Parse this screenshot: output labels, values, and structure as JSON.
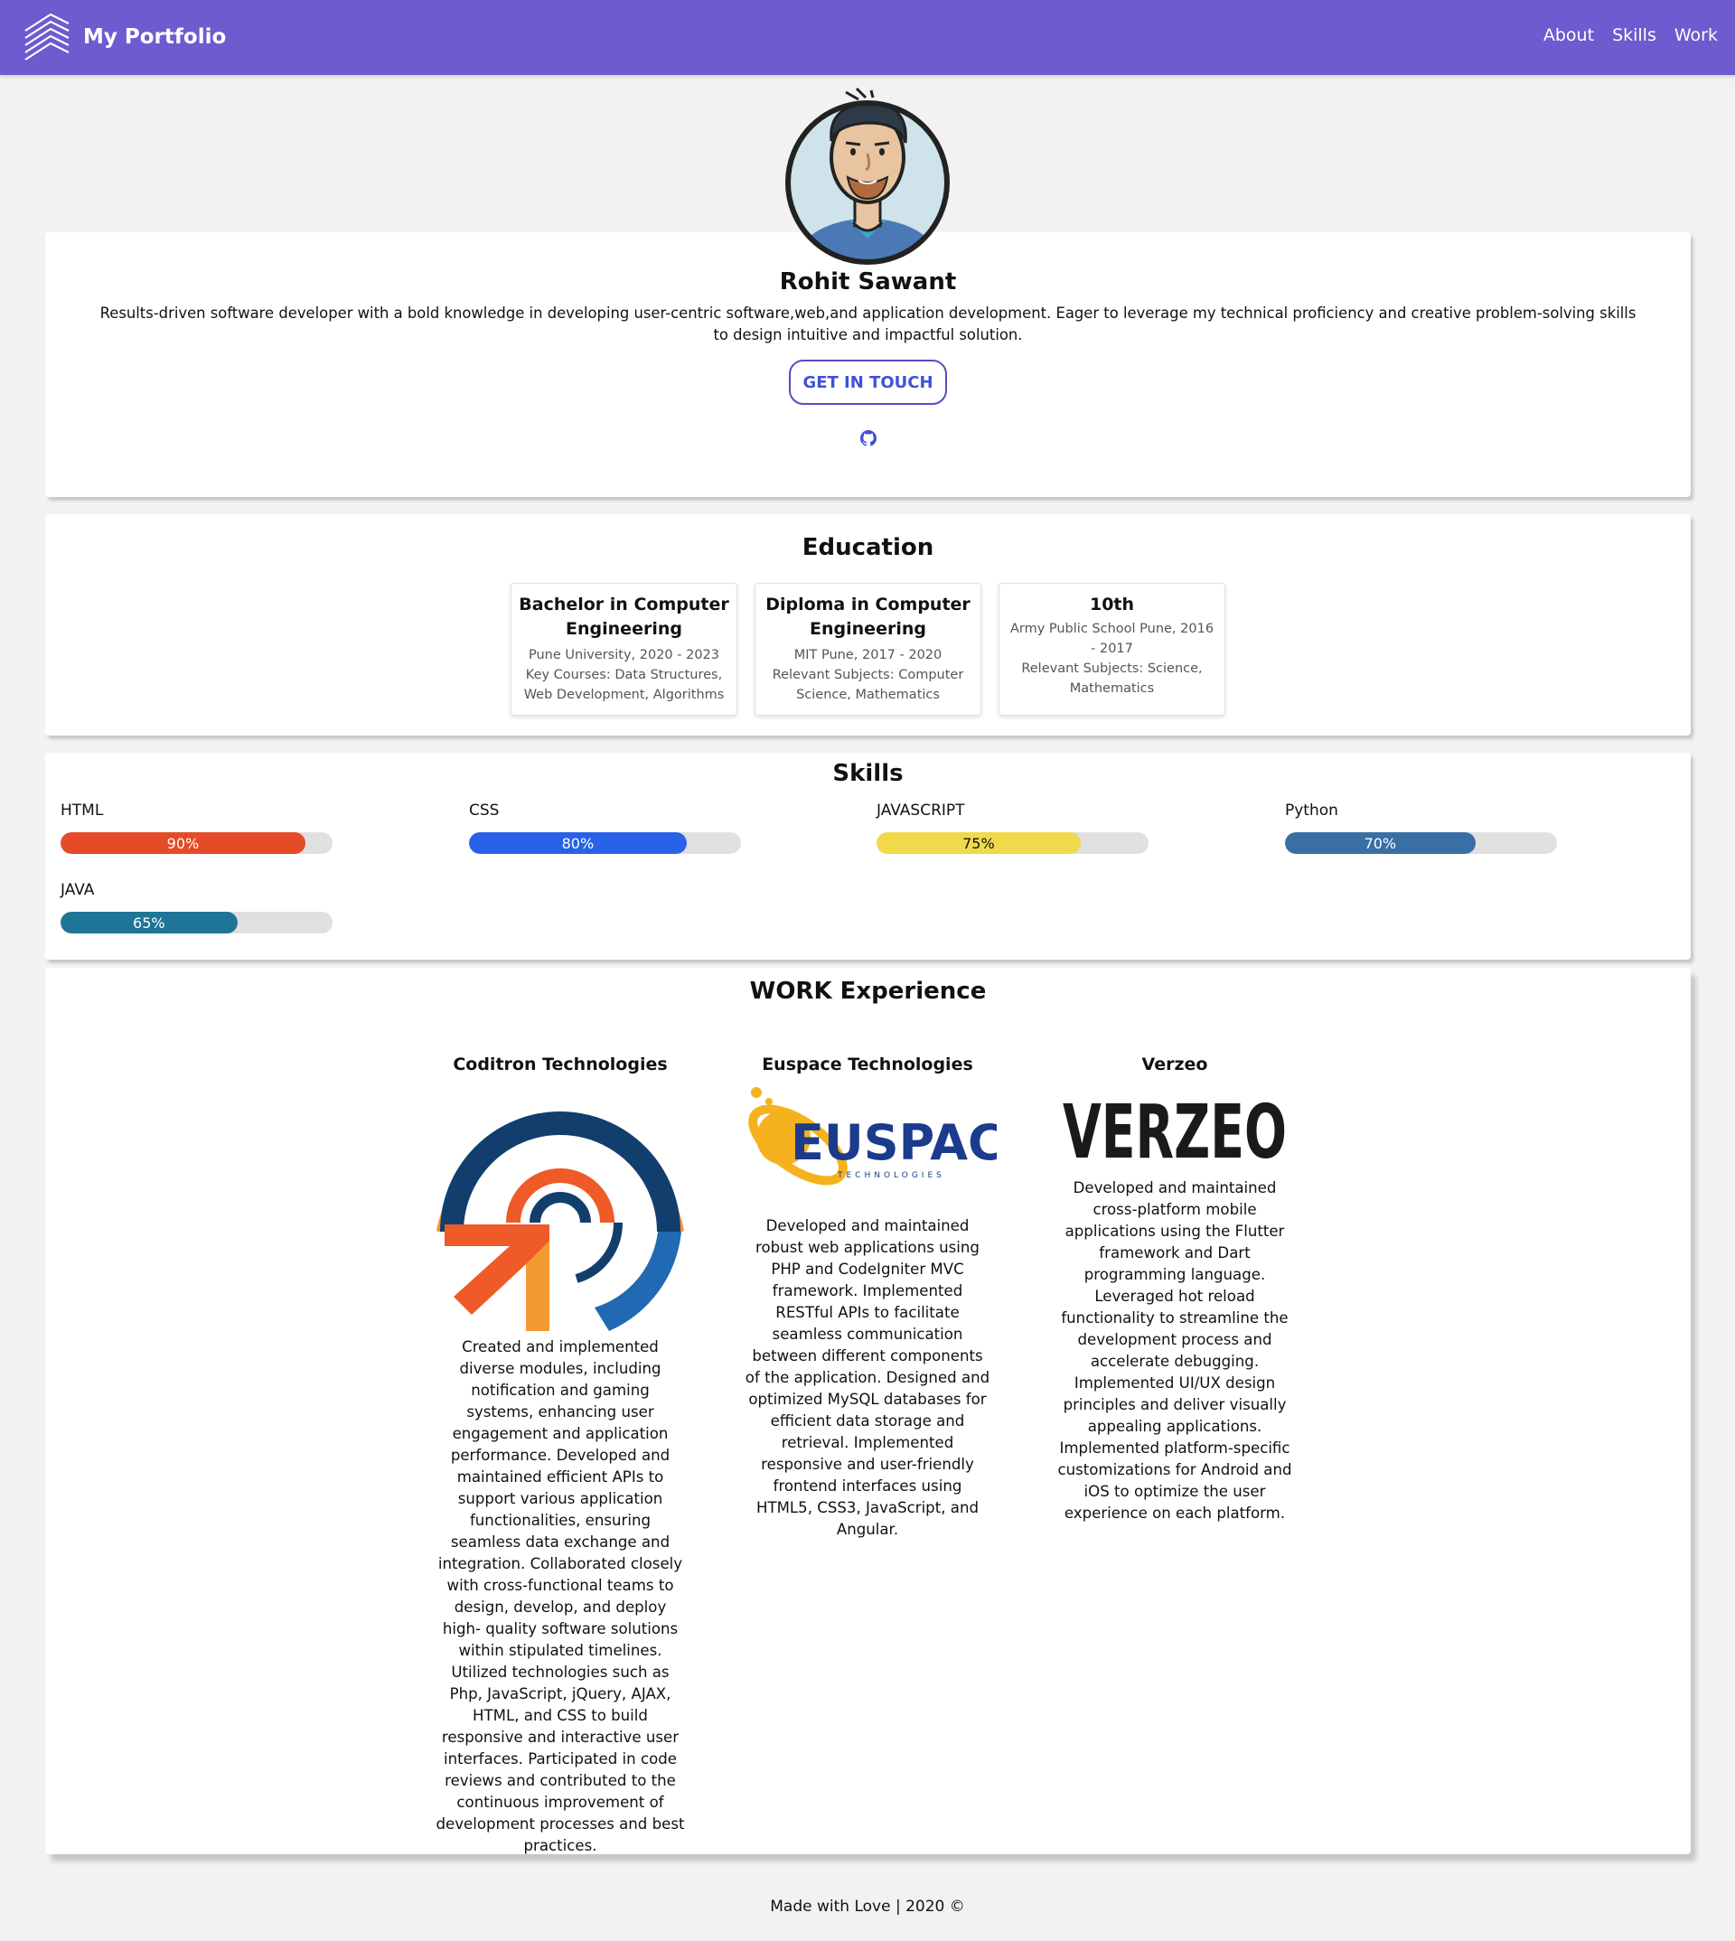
{
  "navbar": {
    "title": "My Portfolio",
    "links": [
      "About",
      "Skills",
      "Work"
    ],
    "bg_color": "#6f5acf"
  },
  "hero": {
    "name": "Rohit Sawant",
    "bio": "Results-driven software developer with a bold knowledge in developing user-centric software,web,and application development. Eager to leverage my technical proficiency and creative problem-solving skills to design intuitive and impactful solution.",
    "cta_label": "GET IN TOUCH",
    "social_icon": "github-icon"
  },
  "education": {
    "title": "Education",
    "items": [
      {
        "degree": "Bachelor in Computer Engineering",
        "institution": "Pune University, 2020 - 2023",
        "subjects": "Key Courses: Data Structures, Web Development, Algorithms"
      },
      {
        "degree": "Diploma in Computer Engineering",
        "institution": "MIT Pune, 2017 - 2020",
        "subjects": "Relevant Subjects: Computer Science, Mathematics"
      },
      {
        "degree": "10th",
        "institution": "Army Public School Pune, 2016 - 2017",
        "subjects": "Relevant Subjects: Science, Mathematics"
      }
    ]
  },
  "skills": {
    "title": "Skills",
    "items": [
      {
        "name": "HTML",
        "label": "90%",
        "level": 0.9,
        "color": "#e54b26",
        "text_color": "#ffffff"
      },
      {
        "name": "CSS",
        "label": "80%",
        "level": 0.8,
        "color": "#2962e8",
        "text_color": "#ffffff"
      },
      {
        "name": "JAVASCRIPT",
        "label": "75%",
        "level": 0.75,
        "color": "#f0d94a",
        "text_color": "#111111"
      },
      {
        "name": "Python",
        "label": "70%",
        "level": 0.7,
        "color": "#3a6fa6",
        "text_color": "#ffffff"
      },
      {
        "name": "JAVA",
        "label": "65%",
        "level": 0.65,
        "color": "#1e7598",
        "text_color": "#ffffff"
      }
    ]
  },
  "work": {
    "title": "WORK Experience",
    "jobs": [
      {
        "company": "Coditron Technologies",
        "logo": "coditron-logo",
        "description": "Created and implemented diverse modules, including notification and gaming systems, enhancing user engagement and application performance. Developed and maintained efficient APIs to support various application functionalities, ensuring seamless data exchange and integration. Collaborated closely with cross-functional teams to design, develop, and deploy high- quality software solutions within stipulated timelines. Utilized technologies such as Php, JavaScript, jQuery, AJAX, HTML, and CSS to build responsive and interactive user interfaces. Participated in code reviews and contributed to the continuous improvement of development processes and best practices."
      },
      {
        "company": "Euspace Technologies",
        "logo": "euspace-logo",
        "logo_text": "EUSPACE",
        "logo_subtext": "TECHNOLOGIES",
        "description": "Developed and maintained robust web applications using PHP and CodeIgniter MVC framework. Implemented RESTful APIs to facilitate seamless communication between different components of the application. Designed and optimized MySQL databases for efficient data storage and retrieval. Implemented responsive and user-friendly frontend interfaces using HTML5, CSS3, JavaScript, and Angular."
      },
      {
        "company": "Verzeo",
        "logo": "verzeo-logo",
        "logo_text": "VERZEO",
        "description": "Developed and maintained cross-platform mobile applications using the Flutter framework and Dart programming language. Leveraged hot reload functionality to streamline the development process and accelerate debugging. Implemented UI/UX design principles and deliver visually appealing applications. Implemented platform-specific customizations for Android and iOS to optimize the user experience on each platform."
      }
    ]
  },
  "footer": {
    "text": "Made with Love | 2020 ©"
  }
}
